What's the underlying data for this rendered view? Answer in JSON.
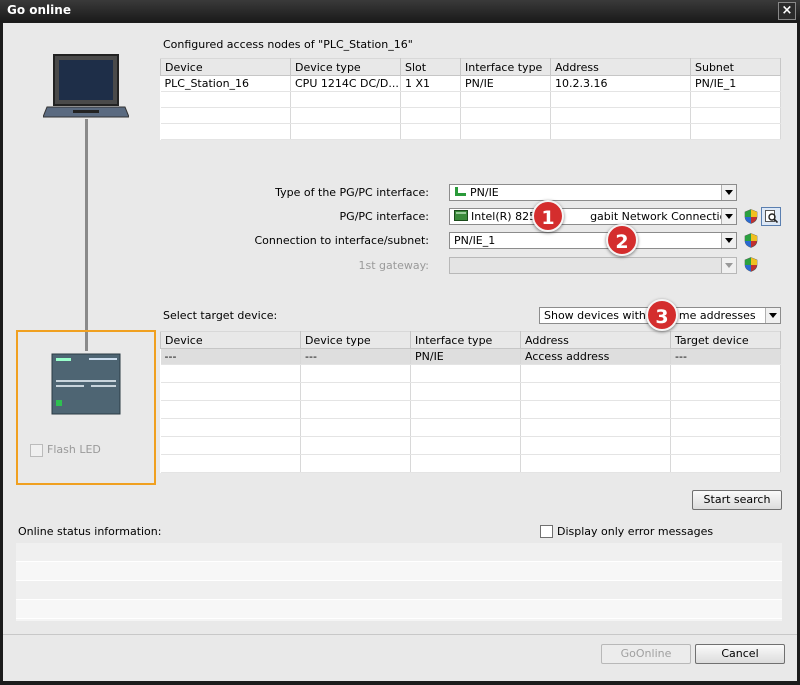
{
  "window": {
    "title": "Go online",
    "close": "×"
  },
  "configured": {
    "title": "Configured access nodes of \"PLC_Station_16\"",
    "columns": [
      "Device",
      "Device type",
      "Slot",
      "Interface type",
      "Address",
      "Subnet"
    ],
    "rows": [
      [
        "PLC_Station_16",
        "CPU 1214C DC/D...",
        "1 X1",
        "PN/IE",
        "10.2.3.16",
        "PN/IE_1"
      ]
    ]
  },
  "interface": {
    "type_label": "Type of the PG/PC interface:",
    "type_value": "PN/IE",
    "pgpc_label": "PG/PC interface:",
    "pgpc_value": "Intel(R) 8257",
    "pgpc_value_rest": "gabit Network Connection",
    "conn_label": "Connection to interface/subnet:",
    "conn_value": "PN/IE_1",
    "gateway_label": "1st gateway:",
    "gateway_value": ""
  },
  "target": {
    "label": "Select target device:",
    "filter_value_a": "Show devices with",
    "filter_value_b": "me addresses",
    "columns": [
      "Device",
      "Device type",
      "Interface type",
      "Address",
      "Target device"
    ],
    "rows": [
      [
        "---",
        "---",
        "PN/IE",
        "Access address",
        "---"
      ]
    ]
  },
  "flash_led": "Flash LED",
  "start_search": "Start search",
  "status": {
    "label": "Online status information:",
    "error_only": "Display only error messages"
  },
  "buttons": {
    "go_online": "GoOnline",
    "cancel": "Cancel"
  },
  "callouts": [
    "1",
    "2",
    "3"
  ],
  "colors": {
    "highlight": "#f0a020",
    "callout": "#d42d2d"
  }
}
